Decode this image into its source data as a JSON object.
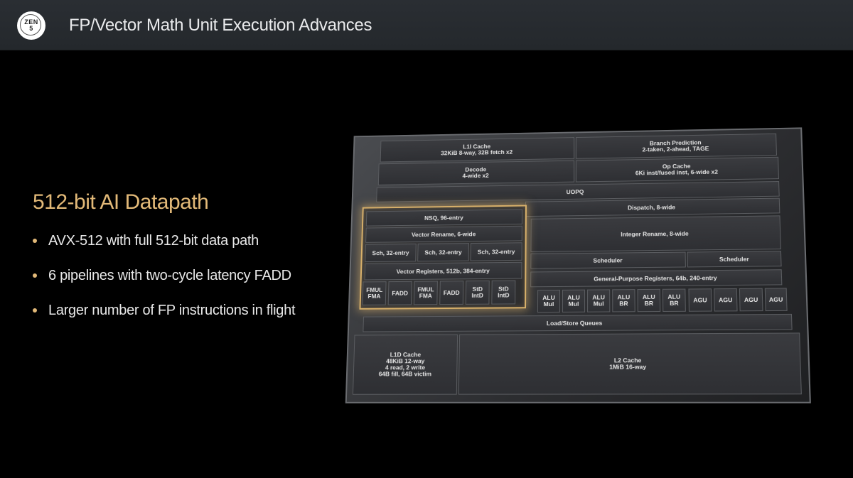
{
  "header": {
    "logo_text_1": "ZEN",
    "logo_text_2": "5",
    "title": "FP/Vector Math Unit Execution Advances"
  },
  "section": {
    "heading": "512-bit AI Datapath",
    "bullets": [
      "AVX-512 with full 512-bit data path",
      "6 pipelines with two-cycle latency FADD",
      "Larger number of FP instructions in flight"
    ]
  },
  "diagram": {
    "l1i": [
      "L1I Cache",
      "32KiB 8-way, 32B fetch x2"
    ],
    "branch": [
      "Branch Prediction",
      "2-taken, 2-ahead, TAGE"
    ],
    "decode": [
      "Decode",
      "4-wide x2"
    ],
    "opcache": [
      "Op Cache",
      "6Ki inst/fused inst, 6-wide x2"
    ],
    "uopq": "UOPQ",
    "dispatch": "Dispatch, 8-wide",
    "nsq": "NSQ, 96-entry",
    "vec_rename": "Vector Rename, 6-wide",
    "fp_sch": [
      "Sch, 32-entry",
      "Sch, 32-entry",
      "Sch, 32-entry"
    ],
    "vec_regs": "Vector Registers, 512b, 384-entry",
    "fp_units": [
      [
        "FMUL",
        "FMA"
      ],
      [
        "FADD",
        ""
      ],
      [
        "FMUL",
        "FMA"
      ],
      [
        "FADD",
        ""
      ],
      [
        "StD",
        "IntD"
      ],
      [
        "StD",
        "IntD"
      ]
    ],
    "int_rename": "Integer Rename, 8-wide",
    "int_sch": [
      "Scheduler",
      "Scheduler"
    ],
    "gpr": "General-Purpose Registers, 64b, 240-entry",
    "int_units": [
      [
        "ALU",
        "Mul"
      ],
      [
        "ALU",
        "Mul"
      ],
      [
        "ALU",
        "Mul"
      ],
      [
        "ALU",
        "BR"
      ],
      [
        "ALU",
        "BR"
      ],
      [
        "ALU",
        "BR"
      ],
      [
        "AGU",
        ""
      ],
      [
        "AGU",
        ""
      ],
      [
        "AGU",
        ""
      ],
      [
        "AGU",
        ""
      ]
    ],
    "lsq": "Load/Store Queues",
    "l1d": [
      "L1D Cache",
      "48KiB 12-way",
      "4 read, 2 write",
      "64B fill, 64B victim"
    ],
    "l2": [
      "L2 Cache",
      "1MiB 16-way"
    ]
  },
  "colors": {
    "accent": "#e2b978",
    "header_bg": "#272b30",
    "background": "#000000"
  }
}
